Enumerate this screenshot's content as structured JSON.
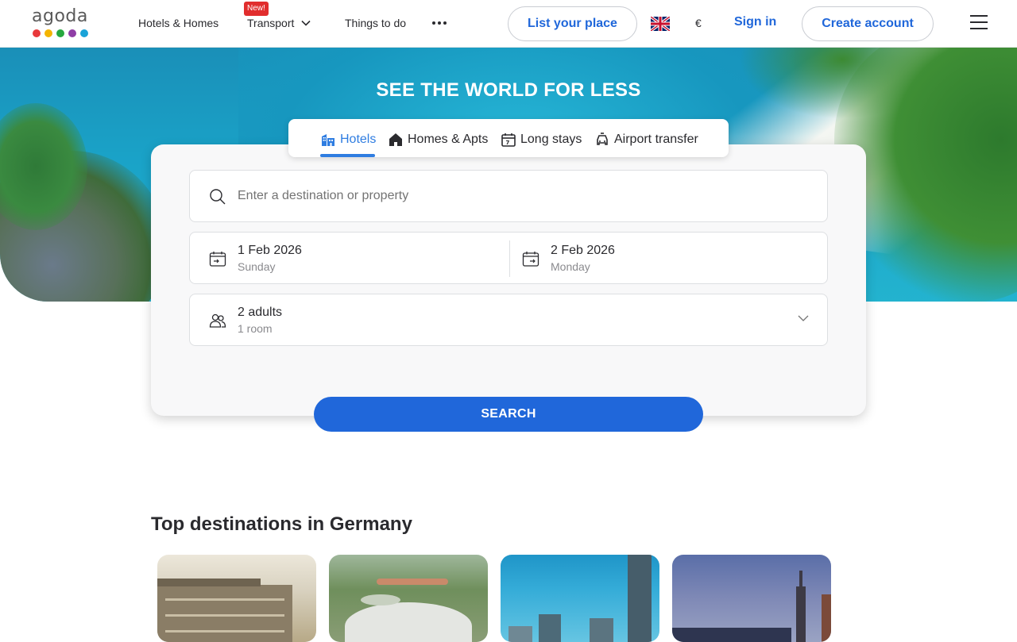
{
  "header": {
    "logo_text": "agoda",
    "logo_dots": [
      "#e8393c",
      "#f4b400",
      "#27a83f",
      "#8f3ea6",
      "#1aa3d8"
    ],
    "nav": {
      "hotels": "Hotels & Homes",
      "transport": "Transport",
      "transport_badge": "New!",
      "things": "Things to do"
    },
    "list_place": "List your place",
    "currency": "€",
    "sign_in": "Sign in",
    "create_account": "Create account"
  },
  "hero": {
    "title": "SEE THE WORLD FOR LESS"
  },
  "tabs": [
    {
      "label": "Hotels",
      "icon": "hotel-icon",
      "active": true
    },
    {
      "label": "Homes & Apts",
      "icon": "home-icon",
      "active": false
    },
    {
      "label": "Long stays",
      "icon": "calendar-7-icon",
      "active": false
    },
    {
      "label": "Airport transfer",
      "icon": "car-icon",
      "active": false
    }
  ],
  "search": {
    "destination_placeholder": "Enter a destination or property",
    "check_in": {
      "date": "1 Feb 2026",
      "day": "Sunday"
    },
    "check_out": {
      "date": "2 Feb 2026",
      "day": "Monday"
    },
    "occupancy": {
      "guests": "2 adults",
      "rooms": "1 room"
    },
    "button": "SEARCH"
  },
  "destinations": {
    "title": "Top destinations in Germany"
  },
  "colors": {
    "primary": "#2067da",
    "tab_active": "#2f7de1",
    "badge": "#e12d2d"
  }
}
